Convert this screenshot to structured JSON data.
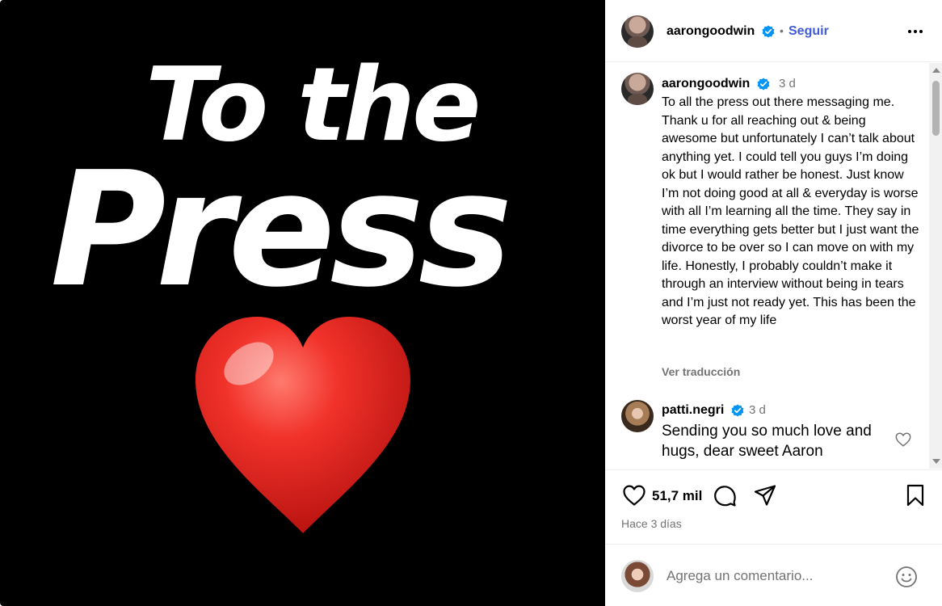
{
  "media": {
    "line1": "To the",
    "line2": "Press",
    "heart_color": "#e0211f"
  },
  "post": {
    "author": "aarongoodwin",
    "verified": true,
    "follow_label": "Seguir",
    "separator": "•",
    "more_icon": "more-horizontal-icon"
  },
  "caption": {
    "username": "aarongoodwin",
    "time": "3 d",
    "text": "To all the press out there messaging me. Thank u for all reaching out & being awesome but unfortunately I can’t talk about anything yet. I could tell you guys I’m doing ok but I would rather be honest. Just know I’m not doing good at all & everyday is worse with all I’m learning all the time. They say in time everything gets better but I just want the divorce to be over so I can move on with my life. Honestly, I probably couldn’t make it through an interview without being in tears and I’m just not ready yet. This has been the worst year of my life",
    "translate_label": "Ver traducción"
  },
  "comments": [
    {
      "username": "patti.negri",
      "verified": true,
      "time": "3 d",
      "text": "Sending you so much love and hugs, dear sweet Aaron"
    }
  ],
  "actions": {
    "likes": "51,7 mil",
    "posted": "Hace 3 días",
    "icons": [
      "heart-icon",
      "comment-icon",
      "share-icon",
      "bookmark-icon"
    ]
  },
  "add_comment": {
    "placeholder": "Agrega un comentario...",
    "emoji_icon": "smiley-icon"
  },
  "colors": {
    "accent_link": "#3f5bd6",
    "verified": "#0095f6",
    "muted_text": "#737373"
  }
}
